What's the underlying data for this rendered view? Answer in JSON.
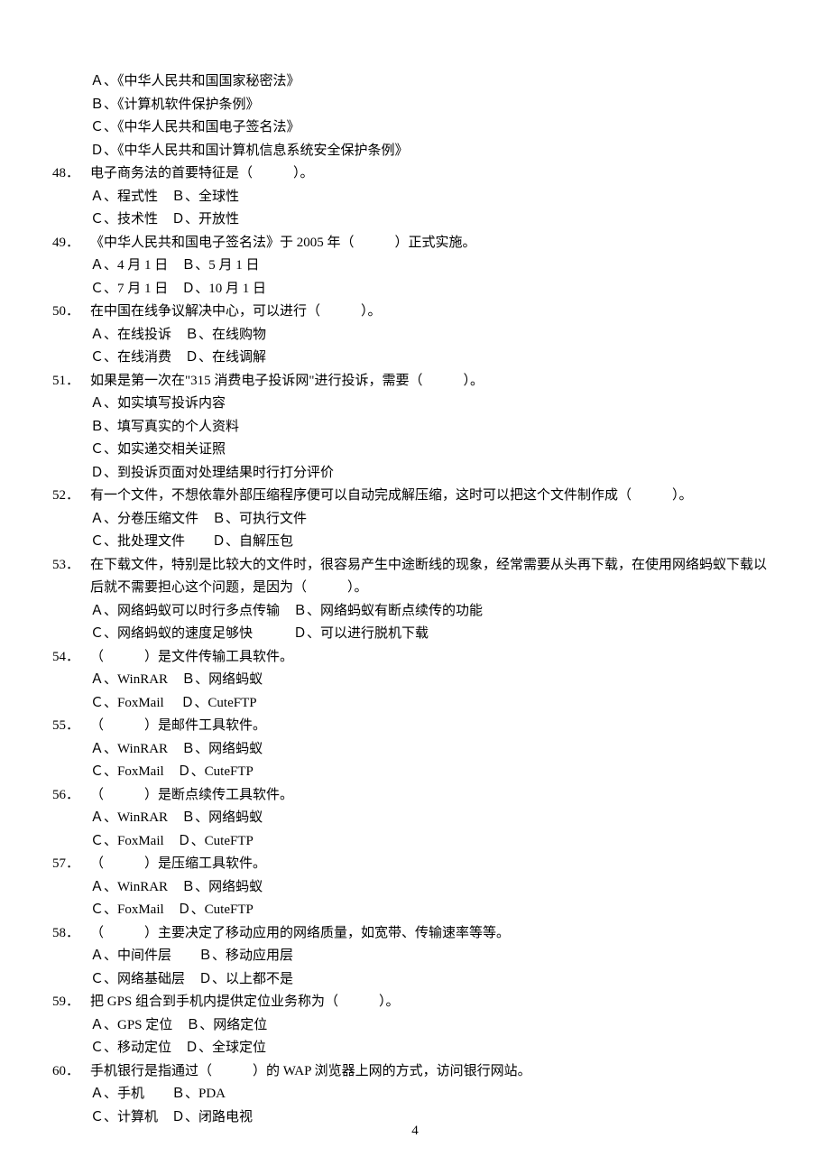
{
  "pageNumber": "4",
  "topOptions": [
    "Ａ、《中华人民共和国国家秘密法》",
    "Ｂ、《计算机软件保护条例》",
    "Ｃ、《中华人民共和国电子签名法》",
    "Ｄ、《中华人民共和国计算机信息系统安全保护条例》"
  ],
  "questions": [
    {
      "num": "48．",
      "stem": "电子商务法的首要特征是（　　　）。",
      "optionLines": [
        "Ａ、程式性　Ｂ、全球性",
        "Ｃ、技术性　Ｄ、开放性"
      ]
    },
    {
      "num": "49．",
      "stem": "《中华人民共和国电子签名法》于 2005 年（　　　）正式实施。",
      "optionLines": [
        "Ａ、4 月 1 日　Ｂ、5 月 1 日",
        "Ｃ、7 月 1 日　Ｄ、10 月 1 日"
      ]
    },
    {
      "num": "50．",
      "stem": "在中国在线争议解决中心，可以进行（　　　）。",
      "optionLines": [
        "Ａ、在线投诉　Ｂ、在线购物",
        "Ｃ、在线消费　Ｄ、在线调解"
      ]
    },
    {
      "num": "51．",
      "stem": "如果是第一次在\"315 消费电子投诉网\"进行投诉，需要（　　　）。",
      "optionLines": [
        "Ａ、如实填写投诉内容",
        "Ｂ、填写真实的个人资料",
        "Ｃ、如实递交相关证照",
        "Ｄ、到投诉页面对处理结果时行打分评价"
      ]
    },
    {
      "num": "52．",
      "stem": "有一个文件，不想依靠外部压缩程序便可以自动完成解压缩，这时可以把这个文件制作成（　　　）。",
      "optionLines": [
        "Ａ、分卷压缩文件　Ｂ、可执行文件",
        "Ｃ、批处理文件　　Ｄ、自解压包"
      ]
    },
    {
      "num": "53．",
      "stem": "在下载文件，特别是比较大的文件时，很容易产生中途断线的现象，经常需要从头再下载，在使用网络蚂蚁下载以后就不需要担心这个问题，是因为（　　　）。",
      "optionLines": [
        "Ａ、网络蚂蚁可以时行多点传输　Ｂ、网络蚂蚁有断点续传的功能",
        "Ｃ、网络蚂蚁的速度足够快　　　Ｄ、可以进行脱机下载"
      ]
    },
    {
      "num": "54．",
      "stem": "（　　　）是文件传输工具软件。",
      "optionLines": [
        "Ａ、WinRAR　Ｂ、网络蚂蚁",
        "Ｃ、FoxMail　 Ｄ、CuteFTP"
      ]
    },
    {
      "num": "55．",
      "stem": "（　　　）是邮件工具软件。",
      "optionLines": [
        "Ａ、WinRAR　Ｂ、网络蚂蚁",
        "Ｃ、FoxMail　Ｄ、CuteFTP"
      ]
    },
    {
      "num": "56．",
      "stem": "（　　　）是断点续传工具软件。",
      "optionLines": [
        "Ａ、WinRAR　Ｂ、网络蚂蚁",
        "Ｃ、FoxMail　Ｄ、CuteFTP"
      ]
    },
    {
      "num": "57．",
      "stem": "（　　　）是压缩工具软件。",
      "optionLines": [
        "Ａ、WinRAR　Ｂ、网络蚂蚁",
        "Ｃ、FoxMail　Ｄ、CuteFTP"
      ]
    },
    {
      "num": "58．",
      "stem": "（　　　）主要决定了移动应用的网络质量，如宽带、传输速率等等。",
      "optionLines": [
        "Ａ、中间件层　　Ｂ、移动应用层",
        "Ｃ、网络基础层　Ｄ、以上都不是"
      ]
    },
    {
      "num": "59．",
      "stem": "把 GPS 组合到手机内提供定位业务称为（　　　）。",
      "optionLines": [
        "Ａ、GPS 定位　Ｂ、网络定位",
        "Ｃ、移动定位　Ｄ、全球定位"
      ]
    },
    {
      "num": "60．",
      "stem": "手机银行是指通过（　　　）的 WAP 浏览器上网的方式，访问银行网站。",
      "optionLines": [
        "Ａ、手机　　Ｂ、PDA",
        "Ｃ、计算机　Ｄ、闭路电视"
      ]
    }
  ]
}
